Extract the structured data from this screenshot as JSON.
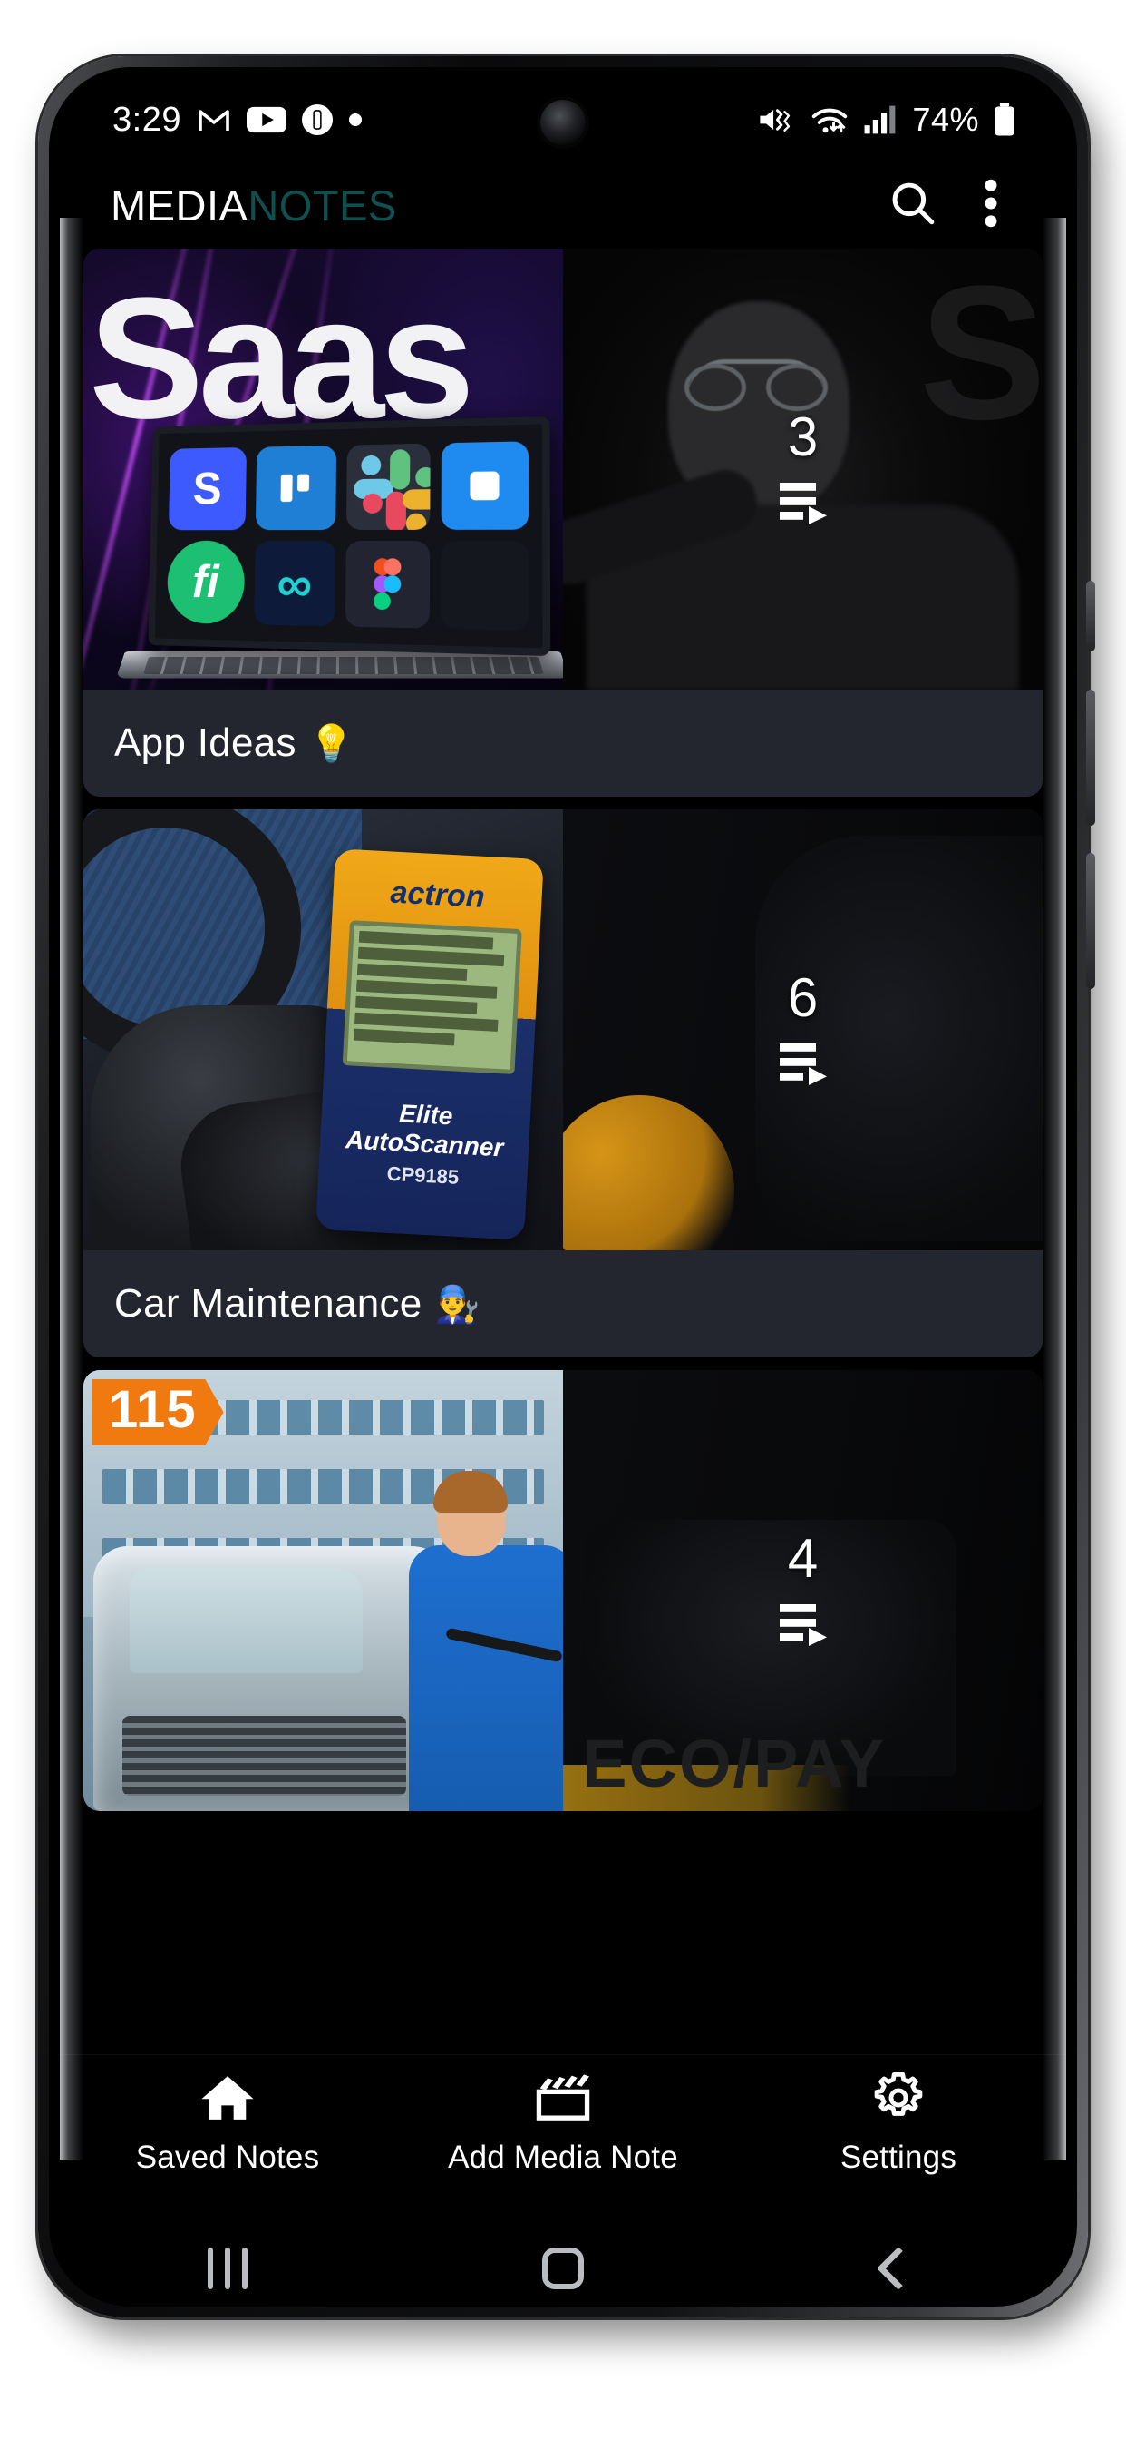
{
  "status_bar": {
    "time": "3:29",
    "left_icons": [
      "gmail-icon",
      "youtube-icon",
      "samsung-notes-icon",
      "dot-indicator-icon"
    ],
    "right_icons": [
      "mute-vibrate-icon",
      "wifi-icon",
      "signal-bars-icon"
    ],
    "battery_percent": "74%"
  },
  "app_bar": {
    "title_part1": "MEDIA",
    "title_part2": "NOTES",
    "title_color1": "#ffffff",
    "title_color2": "#0f4f4e",
    "search_label": "Search",
    "overflow_label": "More options"
  },
  "notes": [
    {
      "title": "App Ideas",
      "emoji": "💡",
      "count": "3",
      "thumb_text": "Saas",
      "thumb_kind": "saas-laptop"
    },
    {
      "title": "Car Maintenance",
      "emoji": "👨‍🔧",
      "count": "6",
      "thumb_text": "actron",
      "thumb_lcd_text": "Elite AutoScanner",
      "thumb_model": "CP9185",
      "thumb_kind": "obd-scanner"
    },
    {
      "title": "",
      "emoji": "",
      "count": "4",
      "thumb_badge": "115",
      "thumb_ghost": "ECO/PAY",
      "thumb_kind": "car-wash"
    }
  ],
  "bottom_nav": {
    "items": [
      {
        "label": "Saved Notes",
        "icon": "home-icon",
        "active": true
      },
      {
        "label": "Add Media Note",
        "icon": "clapperboard-icon",
        "active": false
      },
      {
        "label": "Settings",
        "icon": "gear-icon",
        "active": false
      }
    ]
  },
  "system_nav": {
    "recents_label": "Recents",
    "home_label": "Home",
    "back_label": "Back"
  },
  "colors": {
    "card_bg": "#23252f",
    "screen_bg": "#000000",
    "accent_teal": "#0f4f4e",
    "badge_orange": "#f07a10"
  }
}
